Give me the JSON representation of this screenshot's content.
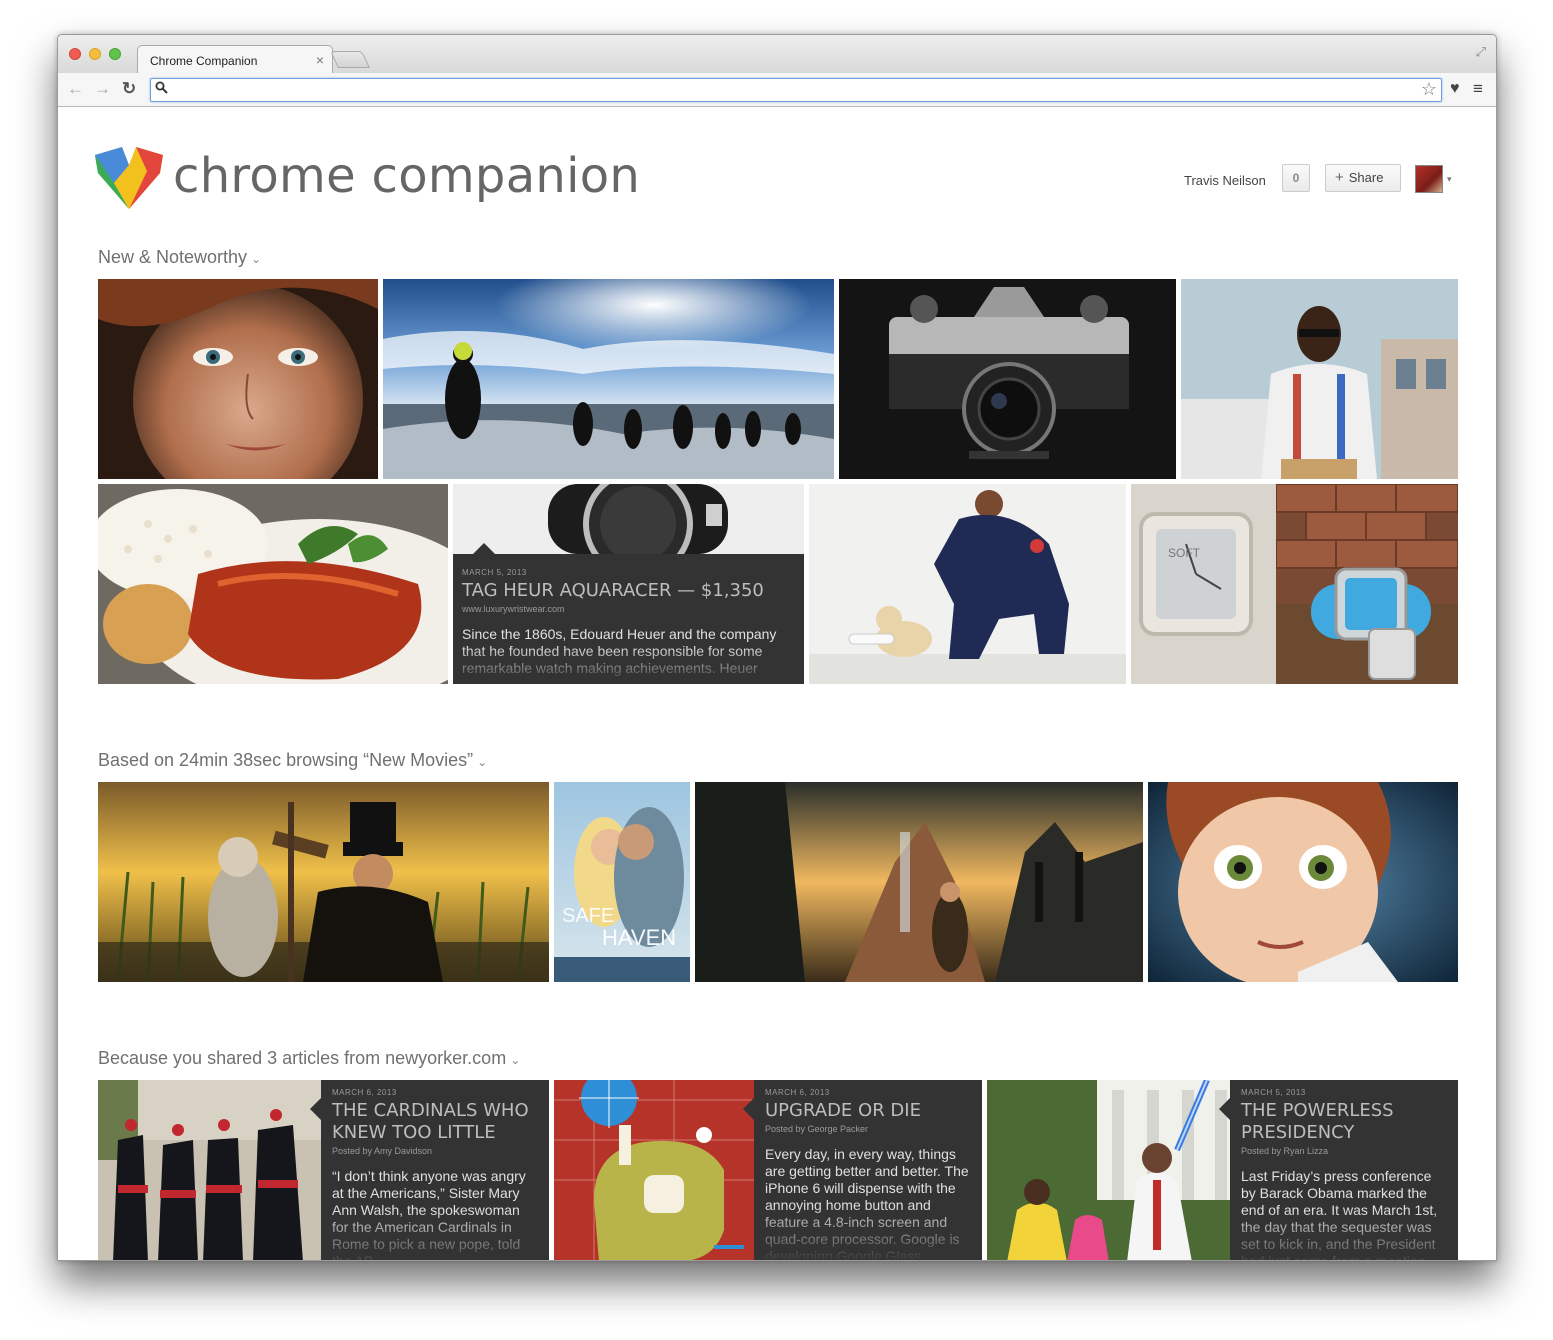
{
  "browser": {
    "tab_title": "Chrome Companion",
    "tab_close": "×",
    "address_value": "",
    "back_glyph": "←",
    "forward_glyph": "→",
    "reload_glyph": "↻",
    "search_glyph": "⚲",
    "star_glyph": "☆",
    "menu_glyph": "≡",
    "ext_glyph": "♥",
    "fullscreen_glyph": "⤢"
  },
  "header": {
    "brand": "chrome companion",
    "user_name": "Travis Neilson",
    "count": "0",
    "share_plus": "+",
    "share_label": "Share",
    "avatar_caret": "▾"
  },
  "sections": {
    "noteworthy": {
      "title": "New & Noteworthy",
      "chev": "⌄"
    },
    "movies": {
      "title": "Based on 24min 38sec browsing “New Movies”",
      "chev": "⌄"
    },
    "newyorker": {
      "title": "Because you shared 3 articles from newyorker.com",
      "chev": "⌄"
    }
  },
  "watch_card": {
    "date": "MARCH 5, 2013",
    "headline": "TAG HEUR AQUARACER — $1,350",
    "source": "www.luxurywristwear.com",
    "body": "Since the 1860s, Edouard Heuer and the company that he founded have been responsible for some remarkable watch making achievements. Heuer"
  },
  "articles": [
    {
      "date": "MARCH 6, 2013",
      "headline": "THE CARDINALS WHO KNEW TOO LITTLE",
      "byline": "Posted by Amy Davidson",
      "body": "“I don’t think anyone was angry at the Americans,” Sister Mary Ann Walsh, the spokeswoman for the American Cardinals in Rome to pick a new pope, told the AP"
    },
    {
      "date": "MARCH 6, 2013",
      "headline": "UPGRADE OR DIE",
      "byline": "Posted by George Packer",
      "body": "Every day, in every way, things are getting better and better. The iPhone 6 will dispense with the annoying home button and feature a 4.8-inch screen and quad-core processor. Google is developing Google Glass,"
    },
    {
      "date": "MARCH 5, 2013",
      "headline": "THE POWERLESS PRESIDENCY",
      "byline": "Posted by Ryan Lizza",
      "body": "Last Friday’s press conference by Barack Obama marked the end of an era. It was March 1st, the day that the sequester was set to kick in, and the President had just come from a meeting"
    }
  ],
  "images": {
    "freckled_girl": "freckled-woman-portrait",
    "triathlon": "triathlon-swim-start",
    "camera": "vintage-camera",
    "man_suspenders": "man-with-suspenders",
    "food": "glazed-chicken-plate",
    "watch": "aquaracer-watch",
    "puppy": "firefighter-with-puppy",
    "soft_watch": "square-watches",
    "oz": "oz-great-powerful-still",
    "safe_haven": "safe-haven-poster",
    "hobbit": "hobbit-rivendell-still",
    "animated_girl": "animated-girl-face",
    "cardinals": "cardinals-walking",
    "robot": "robot-illustration",
    "obama": "obama-lightsaber"
  },
  "poster": {
    "line1": "SAFE",
    "line2": "HAVEN"
  },
  "soft_watch_label": "SOFT"
}
